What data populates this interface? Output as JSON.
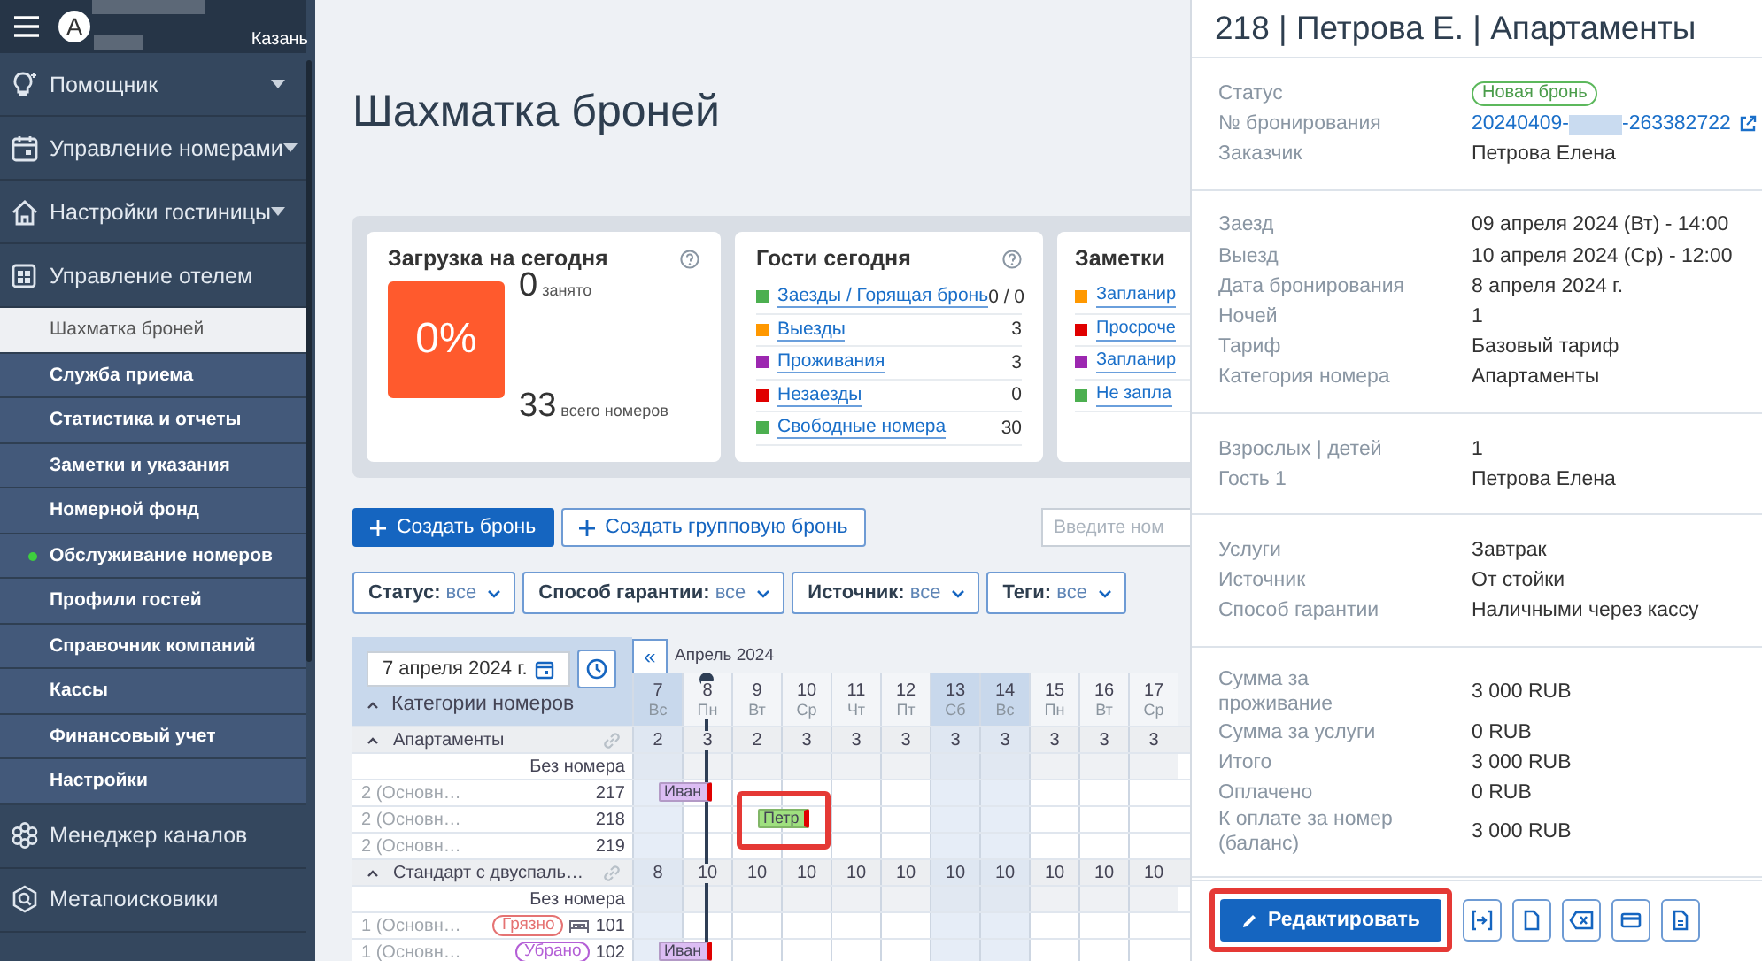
{
  "sidebar": {
    "avatar": "A",
    "city": "Казань",
    "items": [
      {
        "label": "Помощник",
        "caret": true,
        "expanded": false
      },
      {
        "label": "Управление номерами",
        "caret": true,
        "expanded": false
      },
      {
        "label": "Настройки гостиницы",
        "caret": true,
        "expanded": false
      },
      {
        "label": "Управление отелем",
        "caret": false,
        "expanded": true,
        "children": [
          {
            "label": "Шахматка броней",
            "selected": true,
            "dot": false
          },
          {
            "label": "Служба приема",
            "selected": false,
            "dot": false
          },
          {
            "label": "Статистика и отчеты",
            "selected": false,
            "dot": false
          },
          {
            "label": "Заметки и указания",
            "selected": false,
            "dot": false
          },
          {
            "label": "Номерной фонд",
            "selected": false,
            "dot": false
          },
          {
            "label": "Обслуживание номеров",
            "selected": false,
            "dot": true
          },
          {
            "label": "Профили гостей",
            "selected": false,
            "dot": false
          },
          {
            "label": "Справочник компаний",
            "selected": false,
            "dot": false
          },
          {
            "label": "Кассы",
            "selected": false,
            "dot": false
          },
          {
            "label": "Финансовый учет",
            "selected": false,
            "dot": false
          },
          {
            "label": "Настройки",
            "selected": false,
            "dot": false
          }
        ]
      },
      {
        "label": "Менеджер каналов",
        "caret": false,
        "expanded": false
      },
      {
        "label": "Метапоисковики",
        "caret": false,
        "expanded": false
      }
    ]
  },
  "page": {
    "title": "Шахматка броней",
    "load_card": {
      "title": "Загрузка на сегодня",
      "percent": "0%",
      "occupied": "0",
      "occupied_label": "занято",
      "total": "33",
      "total_label": "всего номеров"
    },
    "guests_card": {
      "title": "Гости сегодня",
      "rows": [
        {
          "label": "Заезды / Горящая бронь",
          "value": "0 / 0",
          "color": "#4caf50"
        },
        {
          "label": "Выезды",
          "value": "3",
          "color": "#ff9800"
        },
        {
          "label": "Проживания",
          "value": "3",
          "color": "#9c27b0"
        },
        {
          "label": "Незаезды",
          "value": "0",
          "color": "#e00000"
        },
        {
          "label": "Свободные номера",
          "value": "30",
          "color": "#4caf50"
        }
      ]
    },
    "notes_card": {
      "title": "Заметки",
      "rows": [
        {
          "label": "Запланир",
          "color": "#ff9800"
        },
        {
          "label": "Просроче",
          "color": "#e00000"
        },
        {
          "label": "Запланир",
          "color": "#9c27b0"
        },
        {
          "label": "Не запла",
          "color": "#4caf50"
        }
      ]
    },
    "create_button": "Создать бронь",
    "group_button": "Создать групповую бронь",
    "search": {
      "placeholder": "Введите ном"
    },
    "filters": [
      {
        "label": "Статус:",
        "value": "все"
      },
      {
        "label": "Способ гарантии:",
        "value": "все"
      },
      {
        "label": "Источник:",
        "value": "все"
      },
      {
        "label": "Теги:",
        "value": "все"
      }
    ],
    "calendar": {
      "date": "7 апреля 2024 г.",
      "back": "«",
      "month": "Апрель 2024",
      "header": "Категории номеров",
      "days": [
        {
          "num": "7",
          "wd": "Вс",
          "highlight": true,
          "today": false
        },
        {
          "num": "8",
          "wd": "Пн",
          "highlight": false,
          "today": true
        },
        {
          "num": "9",
          "wd": "Вт",
          "highlight": false,
          "today": false
        },
        {
          "num": "10",
          "wd": "Ср",
          "highlight": false,
          "today": false
        },
        {
          "num": "11",
          "wd": "Чт",
          "highlight": false,
          "today": false
        },
        {
          "num": "12",
          "wd": "Пт",
          "highlight": false,
          "today": false
        },
        {
          "num": "13",
          "wd": "Сб",
          "highlight": true,
          "today": false
        },
        {
          "num": "14",
          "wd": "Вс",
          "highlight": true,
          "today": false
        },
        {
          "num": "15",
          "wd": "Пн",
          "highlight": false,
          "today": false
        },
        {
          "num": "16",
          "wd": "Вт",
          "highlight": false,
          "today": false
        },
        {
          "num": "17",
          "wd": "Ср",
          "highlight": false,
          "today": false
        }
      ],
      "groups": [
        {
          "name": "Апартаменты",
          "expanded": true,
          "counts": [
            "2",
            "3",
            "2",
            "3",
            "3",
            "3",
            "3",
            "3",
            "3",
            "3",
            "3"
          ],
          "rooms": [
            {
              "kind": "unassigned",
              "label": "Без номера"
            },
            {
              "kind": "room",
              "type": "2 (Основн…",
              "number": "217",
              "bed": false,
              "cells": [
                {
                  "booked": true,
                  "guest": "Иван",
                  "color": "#dcbdf3",
                  "unpaid": true,
                  "highlighted": false
                },
                {
                  "booked": false
                },
                {
                  "booked": false
                },
                {
                  "booked": false
                },
                {
                  "booked": false
                },
                {
                  "booked": false
                },
                {
                  "booked": false
                },
                {
                  "booked": false
                },
                {
                  "booked": false
                },
                {
                  "booked": false
                },
                {
                  "booked": false
                }
              ]
            },
            {
              "kind": "room",
              "type": "2 (Основн…",
              "number": "218",
              "bed": false,
              "cells": [
                {
                  "booked": false
                },
                {
                  "booked": false
                },
                {
                  "booked": true,
                  "guest": "Петр",
                  "color": "#9fe07f",
                  "unpaid": true,
                  "highlighted": true
                },
                {
                  "booked": false
                },
                {
                  "booked": false
                },
                {
                  "booked": false
                },
                {
                  "booked": false
                },
                {
                  "booked": false
                },
                {
                  "booked": false
                },
                {
                  "booked": false
                },
                {
                  "booked": false
                }
              ]
            },
            {
              "kind": "room",
              "type": "2 (Основн…",
              "number": "219",
              "bed": false,
              "cells": [
                {
                  "booked": false
                },
                {
                  "booked": false
                },
                {
                  "booked": false
                },
                {
                  "booked": false
                },
                {
                  "booked": false
                },
                {
                  "booked": false
                },
                {
                  "booked": false
                },
                {
                  "booked": false
                },
                {
                  "booked": false
                },
                {
                  "booked": false
                },
                {
                  "booked": false
                }
              ]
            }
          ]
        },
        {
          "name": "Стандарт с двуспаль…",
          "expanded": true,
          "counts": [
            "8",
            "10",
            "10",
            "10",
            "10",
            "10",
            "10",
            "10",
            "10",
            "10",
            "10"
          ],
          "rooms": [
            {
              "kind": "unassigned",
              "label": "Без номера"
            },
            {
              "kind": "room",
              "type": "1 (Основн…",
              "number": "101",
              "bed": true,
              "tag": {
                "label": "Грязно",
                "color": "#e57373"
              },
              "cells": [
                {
                  "booked": false
                },
                {
                  "booked": false
                },
                {
                  "booked": false
                },
                {
                  "booked": false
                },
                {
                  "booked": false
                },
                {
                  "booked": false
                },
                {
                  "booked": false
                },
                {
                  "booked": false
                },
                {
                  "booked": false
                },
                {
                  "booked": false
                },
                {
                  "booked": false
                }
              ]
            },
            {
              "kind": "room",
              "type": "1 (Основн…",
              "number": "102",
              "bed": false,
              "tag": {
                "label": "Убрано",
                "color": "#b45fd6"
              },
              "cells": [
                {
                  "booked": true,
                  "guest": "Иван",
                  "color": "#dcbdf3",
                  "unpaid": true,
                  "highlighted": false
                },
                {
                  "booked": false
                },
                {
                  "booked": false
                },
                {
                  "booked": false
                },
                {
                  "booked": false
                },
                {
                  "booked": false
                },
                {
                  "booked": false
                },
                {
                  "booked": false
                },
                {
                  "booked": false
                },
                {
                  "booked": false
                },
                {
                  "booked": false
                }
              ]
            }
          ]
        }
      ]
    }
  },
  "panel": {
    "title": "218 | Петрова Е. | Апартаменты",
    "sections": [
      {
        "rows": [
          {
            "label": "Статус",
            "kind": "badge",
            "value": "Новая бронь"
          },
          {
            "label": "№ бронирования",
            "kind": "link",
            "parts": [
              "20240409-",
              "-263382722"
            ]
          },
          {
            "label": "Заказчик",
            "kind": "text",
            "value": "Петрова Елена"
          }
        ]
      },
      {
        "rows": [
          {
            "label": "Заезд",
            "kind": "text",
            "value": "09 апреля 2024 (Вт) - 14:00"
          },
          {
            "label": "Выезд",
            "kind": "text",
            "value": "10 апреля 2024 (Ср) - 12:00"
          },
          {
            "label": "Дата бронирования",
            "kind": "text",
            "value": "8 апреля 2024 г."
          },
          {
            "label": "Ночей",
            "kind": "text",
            "value": "1"
          },
          {
            "label": "Тариф",
            "kind": "text",
            "value": "Базовый тариф"
          },
          {
            "label": "Категория номера",
            "kind": "text",
            "value": "Апартаменты"
          }
        ]
      },
      {
        "rows": [
          {
            "label": "Взрослых | детей",
            "kind": "text",
            "value": "1"
          },
          {
            "label": "Гость 1",
            "kind": "text",
            "value": "Петрова Елена"
          }
        ]
      },
      {
        "rows": [
          {
            "label": "Услуги",
            "kind": "text",
            "value": "Завтрак"
          },
          {
            "label": "Источник",
            "kind": "text",
            "value": "От стойки"
          },
          {
            "label": "Способ гарантии",
            "kind": "text",
            "value": "Наличными через кассу"
          }
        ]
      },
      {
        "rows": [
          {
            "label": "Сумма за проживание",
            "kind": "text",
            "value": "3 000 RUB"
          },
          {
            "label": "Сумма за услуги",
            "kind": "text",
            "value": "0 RUB"
          },
          {
            "label": "Итого",
            "kind": "text",
            "value": "3 000 RUB"
          },
          {
            "label": "Оплачено",
            "kind": "text",
            "value": "0 RUB"
          },
          {
            "label": "К оплате за номер (баланс)",
            "kind": "text",
            "value": "3 000 RUB"
          }
        ]
      }
    ],
    "edit_button": {
      "label": "Редактировать",
      "highlighted": true
    }
  }
}
